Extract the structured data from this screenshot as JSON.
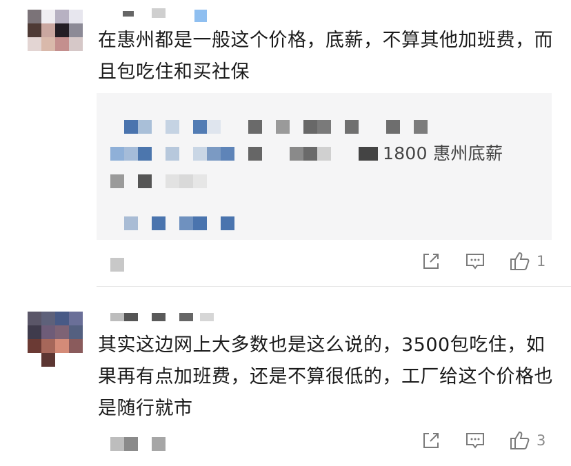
{
  "comments": [
    {
      "text": "在惠州都是一般这个价格，底薪，不算其他加班费，而且包吃住和买社保",
      "quoted_text": "1800 惠州底薪",
      "likes": "1"
    },
    {
      "text": "其实这边网上大多数也是这么说的，3500包吃住，如果再有点加班费，还是不算很低的，工厂给这个价格也是随行就市",
      "likes": "3"
    }
  ],
  "icons": {
    "share": "share-icon",
    "reply": "comment-icon",
    "like": "thumbs-up-icon"
  }
}
